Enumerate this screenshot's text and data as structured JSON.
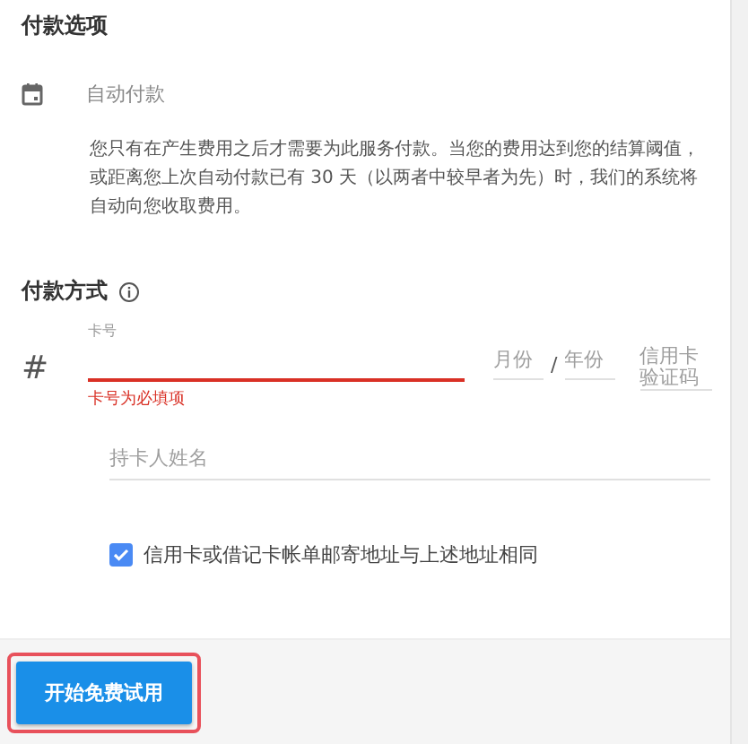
{
  "payment_options": {
    "title": "付款选项",
    "option_label": "自动付款",
    "description": "您只有在产生费用之后才需要为此服务付款。当您的费用达到您的结算阈值，或距离您上次自动付款已有 30 天（以两者中较早者为先）时，我们的系统将自动向您收取费用。"
  },
  "payment_method": {
    "title": "付款方式",
    "card_icon_text": "#",
    "card_number": {
      "label": "卡号",
      "error": "卡号为必填项",
      "invalid": true
    },
    "month": {
      "placeholder": "月份"
    },
    "separator": "/",
    "year": {
      "placeholder": "年份"
    },
    "cvc": {
      "placeholder": "信用卡验证码"
    },
    "cardholder": {
      "placeholder": "持卡人姓名"
    },
    "same_address": {
      "label": "信用卡或借记卡帐单邮寄地址与上述地址相同",
      "checked": true
    }
  },
  "footer": {
    "button": "开始免费试用",
    "highlighted": true
  }
}
